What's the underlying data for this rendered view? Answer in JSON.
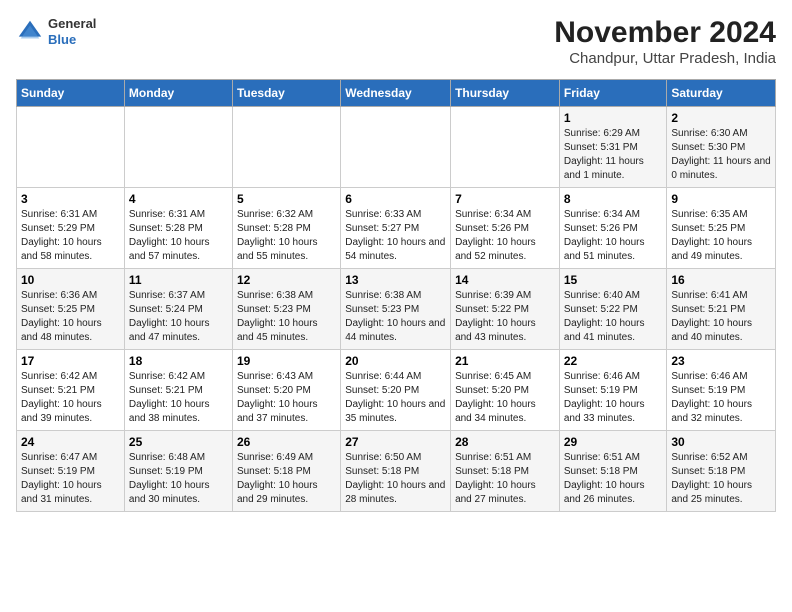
{
  "header": {
    "logo_line1": "General",
    "logo_line2": "Blue",
    "title": "November 2024",
    "subtitle": "Chandpur, Uttar Pradesh, India"
  },
  "columns": [
    "Sunday",
    "Monday",
    "Tuesday",
    "Wednesday",
    "Thursday",
    "Friday",
    "Saturday"
  ],
  "weeks": [
    [
      {
        "day": "",
        "info": ""
      },
      {
        "day": "",
        "info": ""
      },
      {
        "day": "",
        "info": ""
      },
      {
        "day": "",
        "info": ""
      },
      {
        "day": "",
        "info": ""
      },
      {
        "day": "1",
        "info": "Sunrise: 6:29 AM\nSunset: 5:31 PM\nDaylight: 11 hours and 1 minute."
      },
      {
        "day": "2",
        "info": "Sunrise: 6:30 AM\nSunset: 5:30 PM\nDaylight: 11 hours and 0 minutes."
      }
    ],
    [
      {
        "day": "3",
        "info": "Sunrise: 6:31 AM\nSunset: 5:29 PM\nDaylight: 10 hours and 58 minutes."
      },
      {
        "day": "4",
        "info": "Sunrise: 6:31 AM\nSunset: 5:28 PM\nDaylight: 10 hours and 57 minutes."
      },
      {
        "day": "5",
        "info": "Sunrise: 6:32 AM\nSunset: 5:28 PM\nDaylight: 10 hours and 55 minutes."
      },
      {
        "day": "6",
        "info": "Sunrise: 6:33 AM\nSunset: 5:27 PM\nDaylight: 10 hours and 54 minutes."
      },
      {
        "day": "7",
        "info": "Sunrise: 6:34 AM\nSunset: 5:26 PM\nDaylight: 10 hours and 52 minutes."
      },
      {
        "day": "8",
        "info": "Sunrise: 6:34 AM\nSunset: 5:26 PM\nDaylight: 10 hours and 51 minutes."
      },
      {
        "day": "9",
        "info": "Sunrise: 6:35 AM\nSunset: 5:25 PM\nDaylight: 10 hours and 49 minutes."
      }
    ],
    [
      {
        "day": "10",
        "info": "Sunrise: 6:36 AM\nSunset: 5:25 PM\nDaylight: 10 hours and 48 minutes."
      },
      {
        "day": "11",
        "info": "Sunrise: 6:37 AM\nSunset: 5:24 PM\nDaylight: 10 hours and 47 minutes."
      },
      {
        "day": "12",
        "info": "Sunrise: 6:38 AM\nSunset: 5:23 PM\nDaylight: 10 hours and 45 minutes."
      },
      {
        "day": "13",
        "info": "Sunrise: 6:38 AM\nSunset: 5:23 PM\nDaylight: 10 hours and 44 minutes."
      },
      {
        "day": "14",
        "info": "Sunrise: 6:39 AM\nSunset: 5:22 PM\nDaylight: 10 hours and 43 minutes."
      },
      {
        "day": "15",
        "info": "Sunrise: 6:40 AM\nSunset: 5:22 PM\nDaylight: 10 hours and 41 minutes."
      },
      {
        "day": "16",
        "info": "Sunrise: 6:41 AM\nSunset: 5:21 PM\nDaylight: 10 hours and 40 minutes."
      }
    ],
    [
      {
        "day": "17",
        "info": "Sunrise: 6:42 AM\nSunset: 5:21 PM\nDaylight: 10 hours and 39 minutes."
      },
      {
        "day": "18",
        "info": "Sunrise: 6:42 AM\nSunset: 5:21 PM\nDaylight: 10 hours and 38 minutes."
      },
      {
        "day": "19",
        "info": "Sunrise: 6:43 AM\nSunset: 5:20 PM\nDaylight: 10 hours and 37 minutes."
      },
      {
        "day": "20",
        "info": "Sunrise: 6:44 AM\nSunset: 5:20 PM\nDaylight: 10 hours and 35 minutes."
      },
      {
        "day": "21",
        "info": "Sunrise: 6:45 AM\nSunset: 5:20 PM\nDaylight: 10 hours and 34 minutes."
      },
      {
        "day": "22",
        "info": "Sunrise: 6:46 AM\nSunset: 5:19 PM\nDaylight: 10 hours and 33 minutes."
      },
      {
        "day": "23",
        "info": "Sunrise: 6:46 AM\nSunset: 5:19 PM\nDaylight: 10 hours and 32 minutes."
      }
    ],
    [
      {
        "day": "24",
        "info": "Sunrise: 6:47 AM\nSunset: 5:19 PM\nDaylight: 10 hours and 31 minutes."
      },
      {
        "day": "25",
        "info": "Sunrise: 6:48 AM\nSunset: 5:19 PM\nDaylight: 10 hours and 30 minutes."
      },
      {
        "day": "26",
        "info": "Sunrise: 6:49 AM\nSunset: 5:18 PM\nDaylight: 10 hours and 29 minutes."
      },
      {
        "day": "27",
        "info": "Sunrise: 6:50 AM\nSunset: 5:18 PM\nDaylight: 10 hours and 28 minutes."
      },
      {
        "day": "28",
        "info": "Sunrise: 6:51 AM\nSunset: 5:18 PM\nDaylight: 10 hours and 27 minutes."
      },
      {
        "day": "29",
        "info": "Sunrise: 6:51 AM\nSunset: 5:18 PM\nDaylight: 10 hours and 26 minutes."
      },
      {
        "day": "30",
        "info": "Sunrise: 6:52 AM\nSunset: 5:18 PM\nDaylight: 10 hours and 25 minutes."
      }
    ]
  ]
}
